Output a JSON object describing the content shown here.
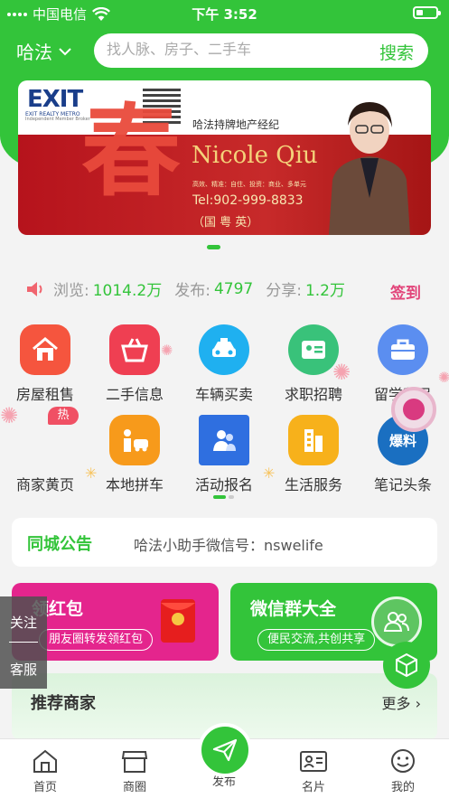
{
  "status_bar": {
    "carrier": "中国电信",
    "time": "下午 3:52"
  },
  "header": {
    "city": "哈法",
    "search_placeholder": "找人脉、房子、二手车",
    "search_button": "搜索"
  },
  "banner": {
    "logo_text": "EXIT",
    "logo_subtitle": "EXIT REALTY METRO",
    "logo_tagline": "Independent Member Broker",
    "big_char": "春",
    "agent_title": "哈法持牌地产经纪",
    "agent_name": "Nicole Qiu",
    "agent_desc": "高效、精准：自住、投资：商业、多单元",
    "phone": "Tel:902-999-8833",
    "languages": "（国 粤 英）"
  },
  "stats": {
    "views_label": "浏览:",
    "views": "1014.2万",
    "posts_label": "发布:",
    "posts": "4797",
    "shares_label": "分享:",
    "shares": "1.2万",
    "signin": "签到"
  },
  "categories": [
    {
      "label": "房屋租售",
      "icon": "house-icon"
    },
    {
      "label": "二手信息",
      "icon": "basket-icon"
    },
    {
      "label": "车辆买卖",
      "icon": "taxi-icon"
    },
    {
      "label": "求职招聘",
      "icon": "id-card-icon"
    },
    {
      "label": "留学移民",
      "icon": "briefcase-icon"
    },
    {
      "label": "商家黄页",
      "icon": "shop-icon",
      "badge": "热"
    },
    {
      "label": "本地拼车",
      "icon": "carpool-icon"
    },
    {
      "label": "活动报名",
      "icon": "people-icon"
    },
    {
      "label": "生活服务",
      "icon": "building-icon"
    },
    {
      "label": "笔记头条",
      "icon": "news-icon",
      "icon_text": "爆料"
    }
  ],
  "notice": {
    "title": "同城公告",
    "content": "哈法小助手微信号：nswelife"
  },
  "cards": {
    "red_packet": {
      "title": "领红包",
      "pill": "朋友圈转发领红包"
    },
    "wechat_group": {
      "title": "微信群大全",
      "pill": "便民交流,共创共享"
    }
  },
  "side_follow": {
    "follow": "关注",
    "service": "客服"
  },
  "recommend": {
    "title": "推荐商家",
    "more": "更多 ›"
  },
  "tabbar": [
    "首页",
    "商圈",
    "发布",
    "名片",
    "我的"
  ],
  "colors": {
    "brand_green": "#33c43a",
    "red_card": "#e4258d",
    "signin_pink": "#e2457a"
  }
}
